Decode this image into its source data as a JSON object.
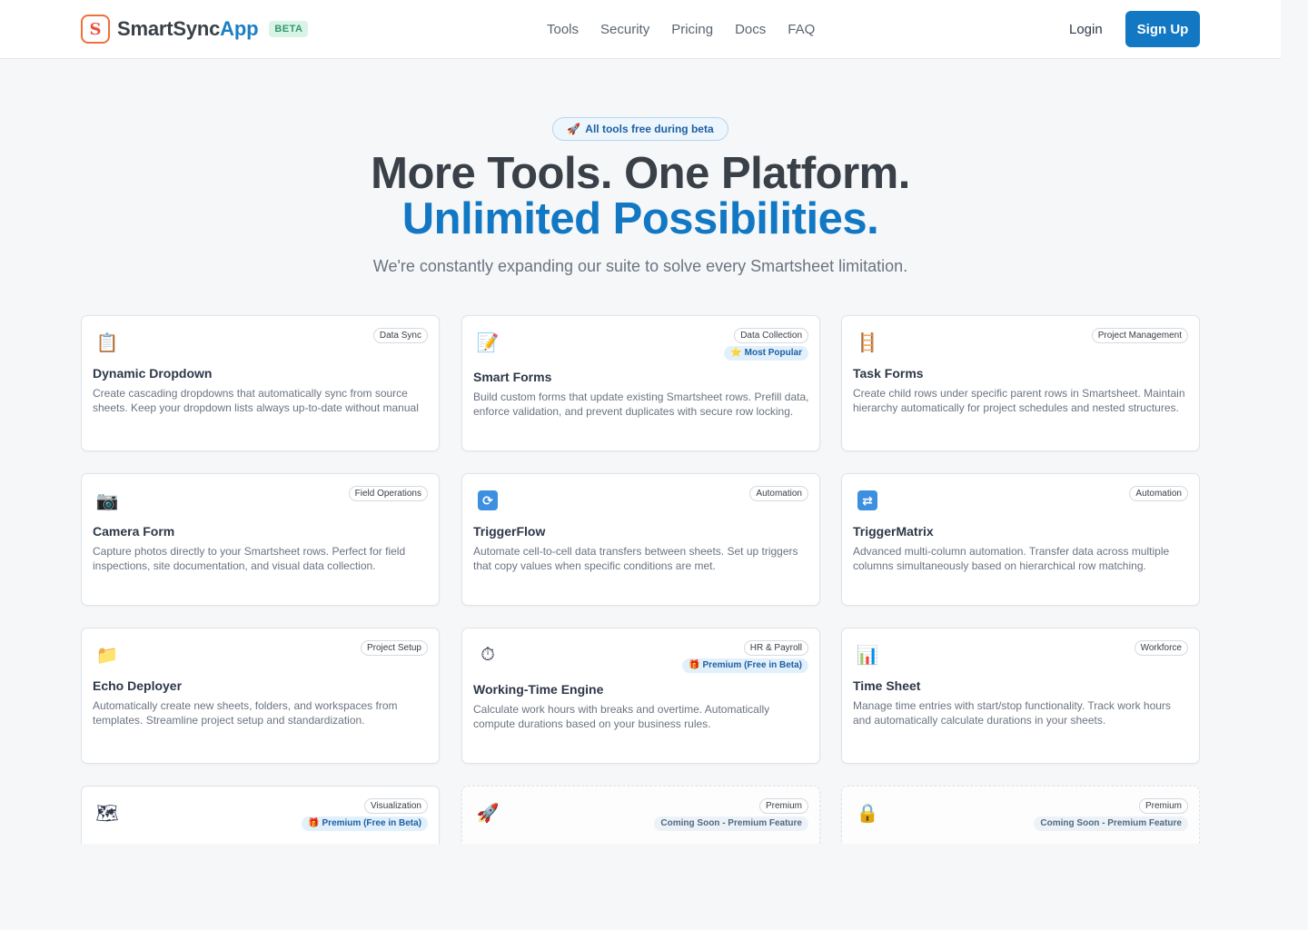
{
  "header": {
    "brand_main": "SmartSync",
    "brand_accent": "App",
    "beta": "BETA",
    "nav": [
      "Tools",
      "Security",
      "Pricing",
      "Docs",
      "FAQ"
    ],
    "login": "Login",
    "signup": "Sign Up"
  },
  "hero": {
    "pill": "All tools free during beta",
    "title_line1": "More Tools. One Platform.",
    "title_line2": "Unlimited Possibilities.",
    "subtitle": "We're constantly expanding our suite to solve every Smartsheet limitation."
  },
  "colors": {
    "primary": "#1278c3",
    "heading": "#3a4047",
    "muted": "#6b7480",
    "beta_green": "#2f9a6a"
  },
  "tools": [
    {
      "icon": "clipboard-icon",
      "category": "Data Sync",
      "badge": "",
      "title": "Dynamic Dropdown",
      "desc": "Create cascading dropdowns that automatically sync from source sheets. Keep your dropdown lists always up-to-date without manual intervention."
    },
    {
      "icon": "memo-icon",
      "category": "Data Collection",
      "badge": "Most Popular",
      "title": "Smart Forms",
      "desc": "Build custom forms that update existing Smartsheet rows. Prefill data, enforce validation, and prevent duplicates with secure row locking."
    },
    {
      "icon": "ladder-icon",
      "category": "Project Management",
      "badge": "",
      "title": "Task Forms",
      "desc": "Create child rows under specific parent rows in Smartsheet. Maintain hierarchy automatically for project schedules and nested structures."
    },
    {
      "icon": "camera-icon",
      "category": "Field Operations",
      "badge": "",
      "title": "Camera Form",
      "desc": "Capture photos directly to your Smartsheet rows. Perfect for field inspections, site documentation, and visual data collection."
    },
    {
      "icon": "sync-icon",
      "category": "Automation",
      "badge": "",
      "title": "TriggerFlow",
      "desc": "Automate cell-to-cell data transfers between sheets. Set up triggers that copy values when specific conditions are met."
    },
    {
      "icon": "shuffle-icon",
      "category": "Automation",
      "badge": "",
      "title": "TriggerMatrix",
      "desc": "Advanced multi-column automation. Transfer data across multiple columns simultaneously based on hierarchical row matching."
    },
    {
      "icon": "folder-icon",
      "category": "Project Setup",
      "badge": "",
      "title": "Echo Deployer",
      "desc": "Automatically create new sheets, folders, and workspaces from templates. Streamline project setup and standardization."
    },
    {
      "icon": "stopwatch-icon",
      "category": "HR & Payroll",
      "badge": "Premium (Free in Beta)",
      "title": "Working-Time Engine",
      "desc": "Calculate work hours with breaks and overtime. Automatically compute durations based on your business rules."
    },
    {
      "icon": "bar-chart-icon",
      "category": "Workforce",
      "badge": "",
      "title": "Time Sheet",
      "desc": "Manage time entries with start/stop functionality. Track work hours and automatically calculate durations in your sheets."
    },
    {
      "icon": "map-icon",
      "category": "Visualization",
      "badge": "Premium (Free in Beta)",
      "title": "",
      "desc": ""
    },
    {
      "icon": "rocket-icon",
      "category": "Premium",
      "badge": "Coming Soon - Premium Feature",
      "title": "",
      "desc": ""
    },
    {
      "icon": "lock-icon",
      "category": "Premium",
      "badge": "Coming Soon - Premium Feature",
      "title": "",
      "desc": ""
    }
  ]
}
